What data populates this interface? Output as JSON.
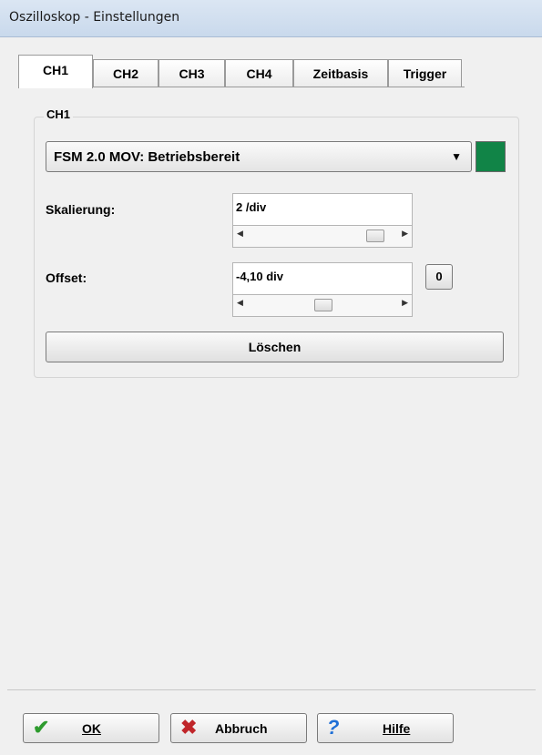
{
  "window": {
    "title": "Oszilloskop - Einstellungen"
  },
  "tabs": [
    {
      "label": "CH1",
      "active": true
    },
    {
      "label": "CH2",
      "active": false
    },
    {
      "label": "CH3",
      "active": false
    },
    {
      "label": "CH4",
      "active": false
    },
    {
      "label": "Zeitbasis",
      "active": false
    },
    {
      "label": "Trigger",
      "active": false
    }
  ],
  "channel": {
    "group_label": "CH1",
    "source_value": "FSM 2.0 MOV: Betriebsbereit",
    "color": "#118447",
    "scaling": {
      "label": "Skalierung:",
      "value": "2  /div",
      "slider_fraction": 0.9
    },
    "offset": {
      "label": "Offset:",
      "value": "-4,10 div",
      "slider_fraction": 0.5,
      "zero_button": "0"
    },
    "clear_button": "Löschen"
  },
  "footer": {
    "ok": {
      "label": "OK",
      "icon": "check-icon"
    },
    "cancel": {
      "label": "Abbruch",
      "icon": "x-icon"
    },
    "help": {
      "label": "Hilfe",
      "icon": "question-icon"
    }
  }
}
